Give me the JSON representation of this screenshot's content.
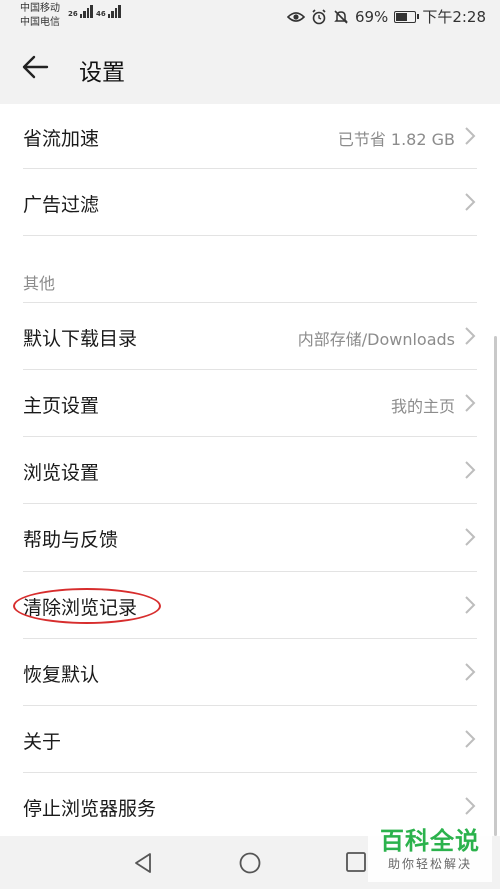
{
  "status_bar": {
    "carrier1": "中国移动",
    "carrier2": "中国电信",
    "net1": "26",
    "net2": "46",
    "battery_percent": "69%",
    "battery_level": 0.69,
    "time": "下午2:28",
    "icons": [
      "eye-icon",
      "alarm-icon",
      "mute-icon",
      "battery-icon"
    ]
  },
  "header": {
    "title": "设置",
    "back_icon": "back-arrow-icon"
  },
  "list": {
    "data_saver": {
      "label": "省流加速",
      "value": "已节省 1.82 GB"
    },
    "ad_filter": {
      "label": "广告过滤"
    },
    "section_other": "其他",
    "download_dir": {
      "label": "默认下载目录",
      "value": "内部存储/Downloads"
    },
    "homepage": {
      "label": "主页设置",
      "value": "我的主页"
    },
    "browse_settings": {
      "label": "浏览设置"
    },
    "help_feedback": {
      "label": "帮助与反馈"
    },
    "clear_history": {
      "label": "清除浏览记录"
    },
    "restore_default": {
      "label": "恢复默认"
    },
    "about": {
      "label": "关于"
    },
    "stop_service": {
      "label": "停止浏览器服务"
    }
  },
  "highlight_color": "#d72d2d",
  "navbar": {
    "icons": [
      "back-triangle-icon",
      "home-circle-icon",
      "recents-square-icon"
    ]
  },
  "watermark": {
    "title": "百科全说",
    "subtitle": "助你轻松解决",
    "color": "#2bb24c"
  }
}
